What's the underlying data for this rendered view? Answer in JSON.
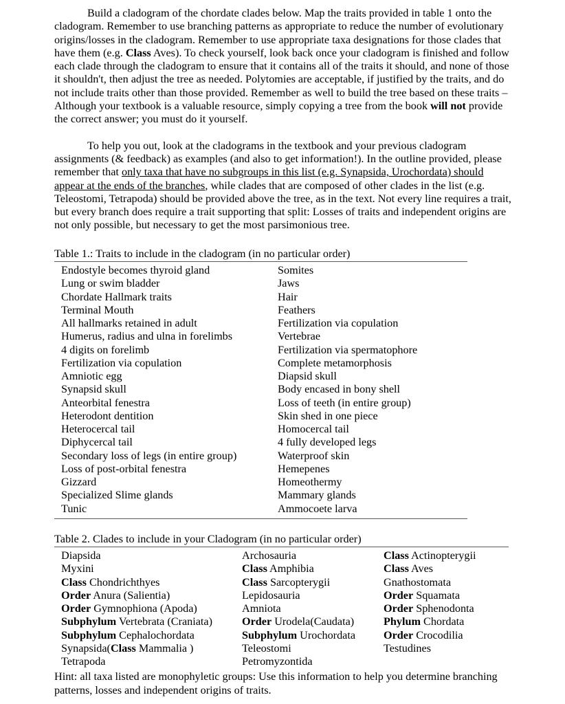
{
  "document": {
    "paragraphs": [
      {
        "id": "intro",
        "runs": [
          {
            "text": "Build a cladogram of the chordate clades below.  Map the traits provided in table 1 onto the cladogram.  Remember to use branching patterns as appropriate to reduce the number of evolutionary origins/losses in the cladogram.  Remember to use appropriate taxa designations for those clades that have them (e.g. ",
            "style": "normal"
          },
          {
            "text": "Class",
            "style": "bold"
          },
          {
            "text": " Aves).  To check yourself, look back once your cladogram is finished and follow each clade through the cladogram to ensure that it contains all of the traits it should, and none of those it shouldn't, then adjust the tree as needed.  Polytomies are acceptable, if justified by the traits, and do not include traits other than those provided.  Remember as well to build the tree based on these traits – Although your textbook is a valuable resource, simply copying a tree from the book ",
            "style": "normal"
          },
          {
            "text": "will not",
            "style": "bold"
          },
          {
            "text": " provide the correct answer; you must do it yourself.",
            "style": "normal"
          }
        ]
      },
      {
        "id": "help",
        "runs": [
          {
            "text": "To help you out, look at the cladograms in the textbook and your previous cladogram assignments (& feedback) as examples (and also to get information!).  In the outline provided, please remember that ",
            "style": "normal"
          },
          {
            "text": "only taxa that have no subgroups in this list (e.g. Synapsida, Urochordata) should appear at the ends of the branches",
            "style": "underline"
          },
          {
            "text": ", while clades that are composed of other clades in the list (e.g. Teleostomi, Tetrapoda) should be provided above the tree, as in the text.  Not every line requires a trait, but every branch does require a trait supporting that split: Losses of traits and independent origins are not only possible, but necessary to get the most parsimonious tree.",
            "style": "normal"
          }
        ]
      }
    ],
    "table1": {
      "caption": "Table 1.:  Traits to include in the cladogram (in no particular order)",
      "rows": [
        [
          "Endostyle becomes thyroid gland",
          "Somites"
        ],
        [
          "Lung or swim bladder",
          "Jaws"
        ],
        [
          "Chordate Hallmark traits",
          "Hair"
        ],
        [
          "Terminal Mouth",
          "Feathers"
        ],
        [
          "All hallmarks retained in adult",
          "Fertilization via copulation"
        ],
        [
          "Humerus, radius and ulna in forelimbs",
          "Vertebrae"
        ],
        [
          "4 digits on forelimb",
          "Fertilization via spermatophore"
        ],
        [
          "Fertilization via copulation",
          "Complete metamorphosis"
        ],
        [
          "Amniotic egg",
          "Diapsid skull"
        ],
        [
          "Synapsid skull",
          "Body encased in bony shell"
        ],
        [
          "Anteorbital fenestra",
          "Loss of teeth (in entire group)"
        ],
        [
          "Heterodont dentition",
          "Skin shed in one piece"
        ],
        [
          "Heterocercal tail",
          "Homocercal tail"
        ],
        [
          "Diphycercal tail",
          "4 fully developed legs"
        ],
        [
          "Secondary loss of legs (in entire group)",
          "Waterproof skin"
        ],
        [
          "Loss of post-orbital fenestra",
          "Hemepenes"
        ],
        [
          "Gizzard",
          "Homeothermy"
        ],
        [
          "Specialized Slime glands",
          "Mammary glands"
        ],
        [
          "Tunic",
          "Ammocoete larva"
        ]
      ]
    },
    "table2": {
      "caption": "Table 2. Clades to include in your Cladogram (in no particular order)",
      "rows": [
        [
          [
            {
              "text": "Diapsida",
              "style": "normal"
            }
          ],
          [
            {
              "text": "Archosauria",
              "style": "normal"
            }
          ],
          [
            {
              "text": "Class",
              "style": "bold"
            },
            {
              "text": " Actinopterygii",
              "style": "normal"
            }
          ]
        ],
        [
          [
            {
              "text": "Myxini",
              "style": "normal"
            }
          ],
          [
            {
              "text": "Class",
              "style": "bold"
            },
            {
              "text": " Amphibia",
              "style": "normal"
            }
          ],
          [
            {
              "text": "Class",
              "style": "bold"
            },
            {
              "text": " Aves",
              "style": "normal"
            }
          ]
        ],
        [
          [
            {
              "text": "Class",
              "style": "bold"
            },
            {
              "text": " Chondrichthyes",
              "style": "normal"
            }
          ],
          [
            {
              "text": "Class",
              "style": "bold"
            },
            {
              "text": " Sarcopterygii",
              "style": "normal"
            }
          ],
          [
            {
              "text": "Gnathostomata",
              "style": "normal"
            }
          ]
        ],
        [
          [
            {
              "text": "Order",
              "style": "bold"
            },
            {
              "text": " Anura (Salientia)",
              "style": "normal"
            }
          ],
          [
            {
              "text": "Lepidosauria",
              "style": "normal"
            }
          ],
          [
            {
              "text": "Order",
              "style": "bold"
            },
            {
              "text": " Squamata",
              "style": "normal"
            }
          ]
        ],
        [
          [
            {
              "text": "Order",
              "style": "bold"
            },
            {
              "text": " Gymnophiona (Apoda)",
              "style": "normal"
            }
          ],
          [
            {
              "text": "Amniota",
              "style": "normal"
            }
          ],
          [
            {
              "text": "Order",
              "style": "bold"
            },
            {
              "text": " Sphenodonta",
              "style": "normal"
            }
          ]
        ],
        [
          [
            {
              "text": "Subphylum",
              "style": "bold"
            },
            {
              "text": " Vertebrata (Craniata)",
              "style": "normal"
            }
          ],
          [
            {
              "text": "Order",
              "style": "bold"
            },
            {
              "text": " Urodela(Caudata)",
              "style": "normal"
            }
          ],
          [
            {
              "text": "Phylum",
              "style": "bold"
            },
            {
              "text": " Chordata",
              "style": "normal"
            }
          ]
        ],
        [
          [
            {
              "text": "Subphylum",
              "style": "bold"
            },
            {
              "text": " Cephalochordata",
              "style": "normal"
            }
          ],
          [
            {
              "text": "Subphylum",
              "style": "bold"
            },
            {
              "text": " Urochordata",
              "style": "normal"
            }
          ],
          [
            {
              "text": "Order",
              "style": "bold"
            },
            {
              "text": " Crocodilia",
              "style": "normal"
            }
          ]
        ],
        [
          [
            {
              "text": "Synapsida(",
              "style": "normal"
            },
            {
              "text": "Class",
              "style": "bold"
            },
            {
              "text": " Mammalia )",
              "style": "normal"
            }
          ],
          [
            {
              "text": "Teleostomi",
              "style": "normal"
            }
          ],
          [
            {
              "text": "Testudines",
              "style": "normal"
            }
          ]
        ],
        [
          [
            {
              "text": "Tetrapoda",
              "style": "normal"
            }
          ],
          [
            {
              "text": "Petromyzontida",
              "style": "normal"
            }
          ],
          []
        ]
      ]
    },
    "hint": "Hint:  all taxa listed are monophyletic groups:  Use this information to help you determine branching patterns, losses and independent origins of traits."
  }
}
